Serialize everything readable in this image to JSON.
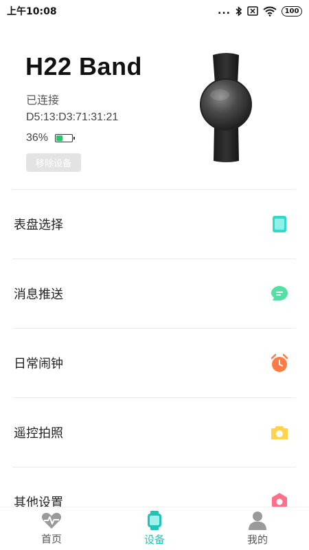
{
  "status_bar": {
    "time": "上午10:08",
    "dots": "...",
    "battery": "100"
  },
  "device": {
    "name": "H22 Band",
    "status": "已连接",
    "mac": "D5:13:D3:71:31:21",
    "battery_percent": "36%",
    "battery_level": 0.36,
    "remove_button": "移除设备"
  },
  "menu": {
    "items": [
      {
        "label": "表盘选择",
        "icon": "watch-face-icon",
        "color": "#2fd9cc"
      },
      {
        "label": "消息推送",
        "icon": "message-icon",
        "color": "#52e0a4"
      },
      {
        "label": "日常闹钟",
        "icon": "alarm-clock-icon",
        "color": "#ff7a45"
      },
      {
        "label": "遥控拍照",
        "icon": "camera-icon",
        "color": "#ffd34d"
      },
      {
        "label": "其他设置",
        "icon": "settings-icon",
        "color": "#ff6f8a"
      }
    ]
  },
  "tabbar": {
    "tabs": [
      {
        "label": "首页",
        "icon": "heart-rate-icon",
        "active": false
      },
      {
        "label": "设备",
        "icon": "watch-icon",
        "active": true
      },
      {
        "label": "我的",
        "icon": "person-icon",
        "active": false
      }
    ],
    "active_color": "#1fc3b8",
    "inactive_color": "#8a8a8a"
  }
}
